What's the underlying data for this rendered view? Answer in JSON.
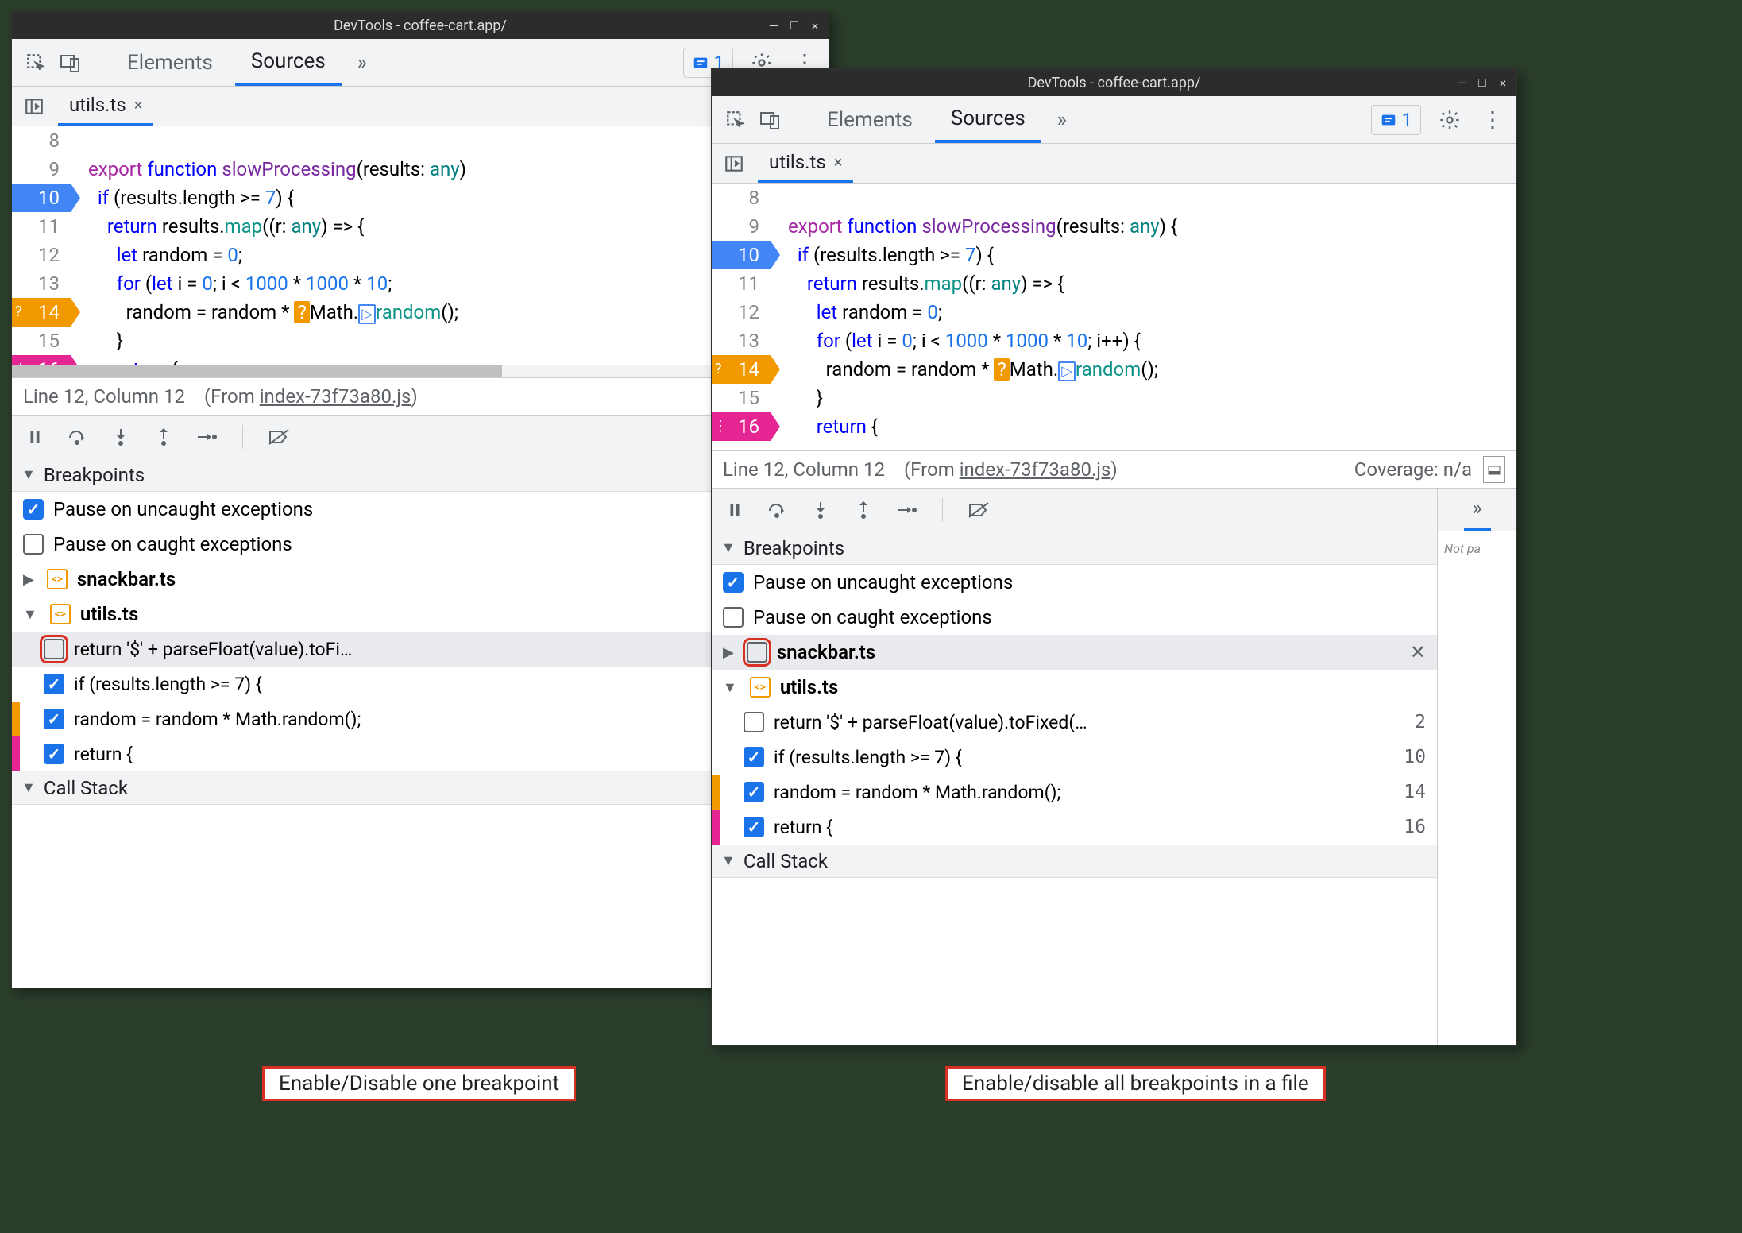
{
  "titlebar": {
    "title": "DevTools - coffee-cart.app/"
  },
  "toolbar": {
    "tab_elements": "Elements",
    "tab_sources": "Sources",
    "issues_count": "1"
  },
  "file_tab": {
    "name": "utils.ts"
  },
  "code_lines": [
    {
      "n": 8,
      "bp": null,
      "html": "export function slowProcessing(results: any)"
    },
    {
      "n": 9,
      "bp": null
    },
    {
      "n": 10,
      "bp": "blue"
    },
    {
      "n": 11,
      "bp": null
    },
    {
      "n": 12,
      "bp": null
    },
    {
      "n": 13,
      "bp": null
    },
    {
      "n": 14,
      "bp": "orange"
    },
    {
      "n": 15,
      "bp": null
    },
    {
      "n": 16,
      "bp": "pink"
    }
  ],
  "statusbar": {
    "pos": "Line 12, Column 12",
    "from_prefix": "(From ",
    "from_file": "index-73f73a80.js",
    "from_suffix": ")",
    "coverage_left": "Coverage: n/",
    "coverage_right": "Coverage: n/a"
  },
  "breakpoints_section": {
    "title": "Breakpoints"
  },
  "exceptions": {
    "uncaught": "Pause on uncaught exceptions",
    "caught": "Pause on caught exceptions"
  },
  "files": {
    "snackbar": "snackbar.ts",
    "utils": "utils.ts"
  },
  "bp_items": {
    "bp1_text": "return '$' + parseFloat(value).toFi…",
    "bp1_text_b": "return '$' + parseFloat(value).toFixed(…",
    "bp1_line": "2",
    "bp2_text": "if (results.length >= 7) {",
    "bp2_line": "10",
    "bp3_text": "random = random * Math.random();",
    "bp3_line": "14",
    "bp4_text": "return {",
    "bp4_line": "16"
  },
  "callstack": {
    "title": "Call Stack"
  },
  "right_pane": {
    "not_paused": "Not pa"
  },
  "captions": {
    "left": "Enable/Disable one breakpoint",
    "right": "Enable/disable all breakpoints in a file"
  }
}
